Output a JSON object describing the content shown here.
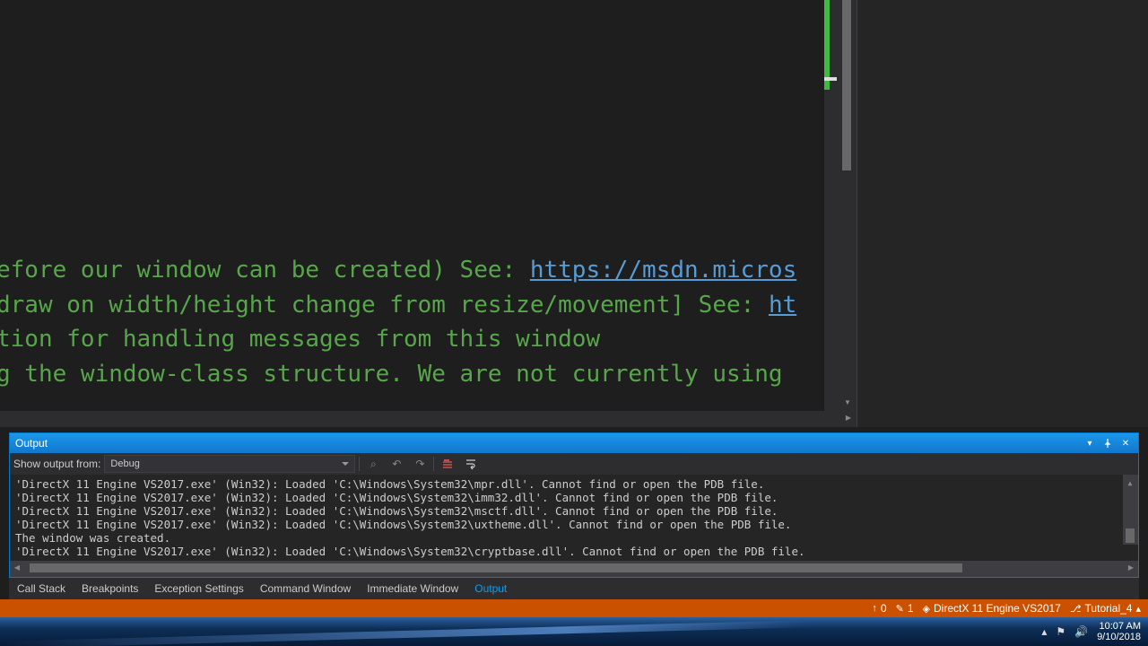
{
  "editor": {
    "line1_pre": "efore our window can be created) See: ",
    "line1_link": "https://msdn.micros",
    "line2_pre": "draw on width/height change from resize/movement] See: ",
    "line2_link": "ht",
    "line3": "tion for handling messages from this window",
    "line4": "g the window-class structure. We are not currently using"
  },
  "output": {
    "title": "Output",
    "show_label": "Show output from:",
    "source": "Debug",
    "lines": [
      "'DirectX 11 Engine VS2017.exe' (Win32): Loaded 'C:\\Windows\\System32\\mpr.dll'. Cannot find or open the PDB file.",
      "'DirectX 11 Engine VS2017.exe' (Win32): Loaded 'C:\\Windows\\System32\\imm32.dll'. Cannot find or open the PDB file.",
      "'DirectX 11 Engine VS2017.exe' (Win32): Loaded 'C:\\Windows\\System32\\msctf.dll'. Cannot find or open the PDB file.",
      "'DirectX 11 Engine VS2017.exe' (Win32): Loaded 'C:\\Windows\\System32\\uxtheme.dll'. Cannot find or open the PDB file.",
      "The window was created.",
      "'DirectX 11 Engine VS2017.exe' (Win32): Loaded 'C:\\Windows\\System32\\cryptbase.dll'. Cannot find or open the PDB file."
    ]
  },
  "tabs": [
    "Call Stack",
    "Breakpoints",
    "Exception Settings",
    "Command Window",
    "Immediate Window",
    "Output"
  ],
  "active_tab": "Output",
  "status": {
    "up_count": "0",
    "edit_count": "1",
    "project": "DirectX 11 Engine VS2017",
    "solution": "Tutorial_4"
  },
  "tray": {
    "time": "10:07 AM",
    "date": "9/10/2018"
  }
}
